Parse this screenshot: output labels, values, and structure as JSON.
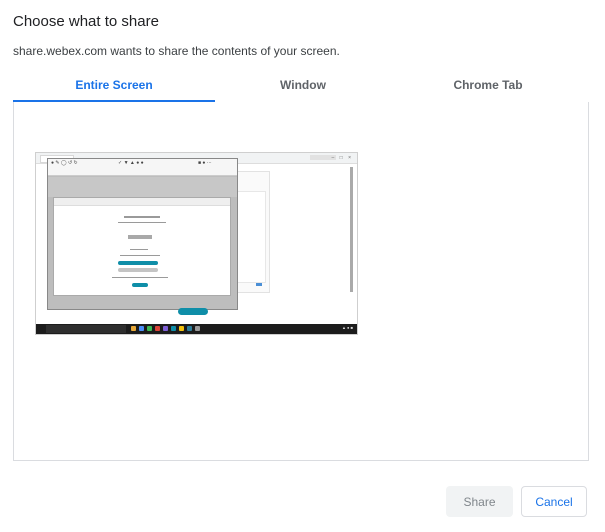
{
  "dialog": {
    "title": "Choose what to share",
    "subtitle": "share.webex.com wants to share the contents of your screen."
  },
  "tabs": [
    {
      "label": "Entire Screen",
      "active": true
    },
    {
      "label": "Window",
      "active": false
    },
    {
      "label": "Chrome Tab",
      "active": false
    }
  ],
  "colors": {
    "accent": "#1a73e8",
    "tab_inactive": "#5f6368",
    "border": "#dadce0",
    "disabled_button_bg": "#f1f3f4",
    "teal": "#0f8ea8"
  },
  "buttons": {
    "share_label": "Share",
    "cancel_label": "Cancel"
  },
  "share_enabled": false
}
